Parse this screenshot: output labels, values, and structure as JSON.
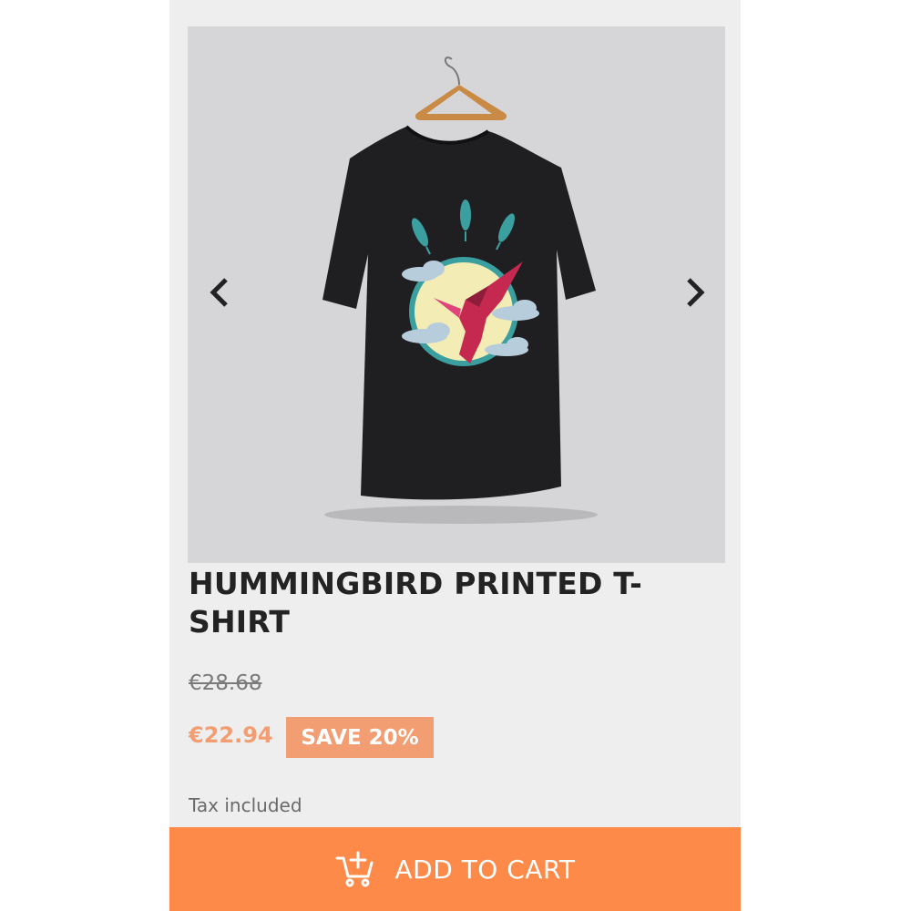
{
  "product": {
    "title": "HUMMINGBIRD PRINTED T-SHIRT",
    "old_price": "€28.68",
    "price": "€22.94",
    "discount_badge": "SAVE 20%",
    "tax_note": "Tax included"
  },
  "gallery": {
    "prev_icon": "chevron-left-icon",
    "next_icon": "chevron-right-icon"
  },
  "cart": {
    "label": "ADD TO CART",
    "icon": "add-to-cart-icon"
  },
  "colors": {
    "accent": "#fe8a4a",
    "price": "#f39d72",
    "background": "#eeeeee",
    "image_background": "#d6d6d8"
  }
}
